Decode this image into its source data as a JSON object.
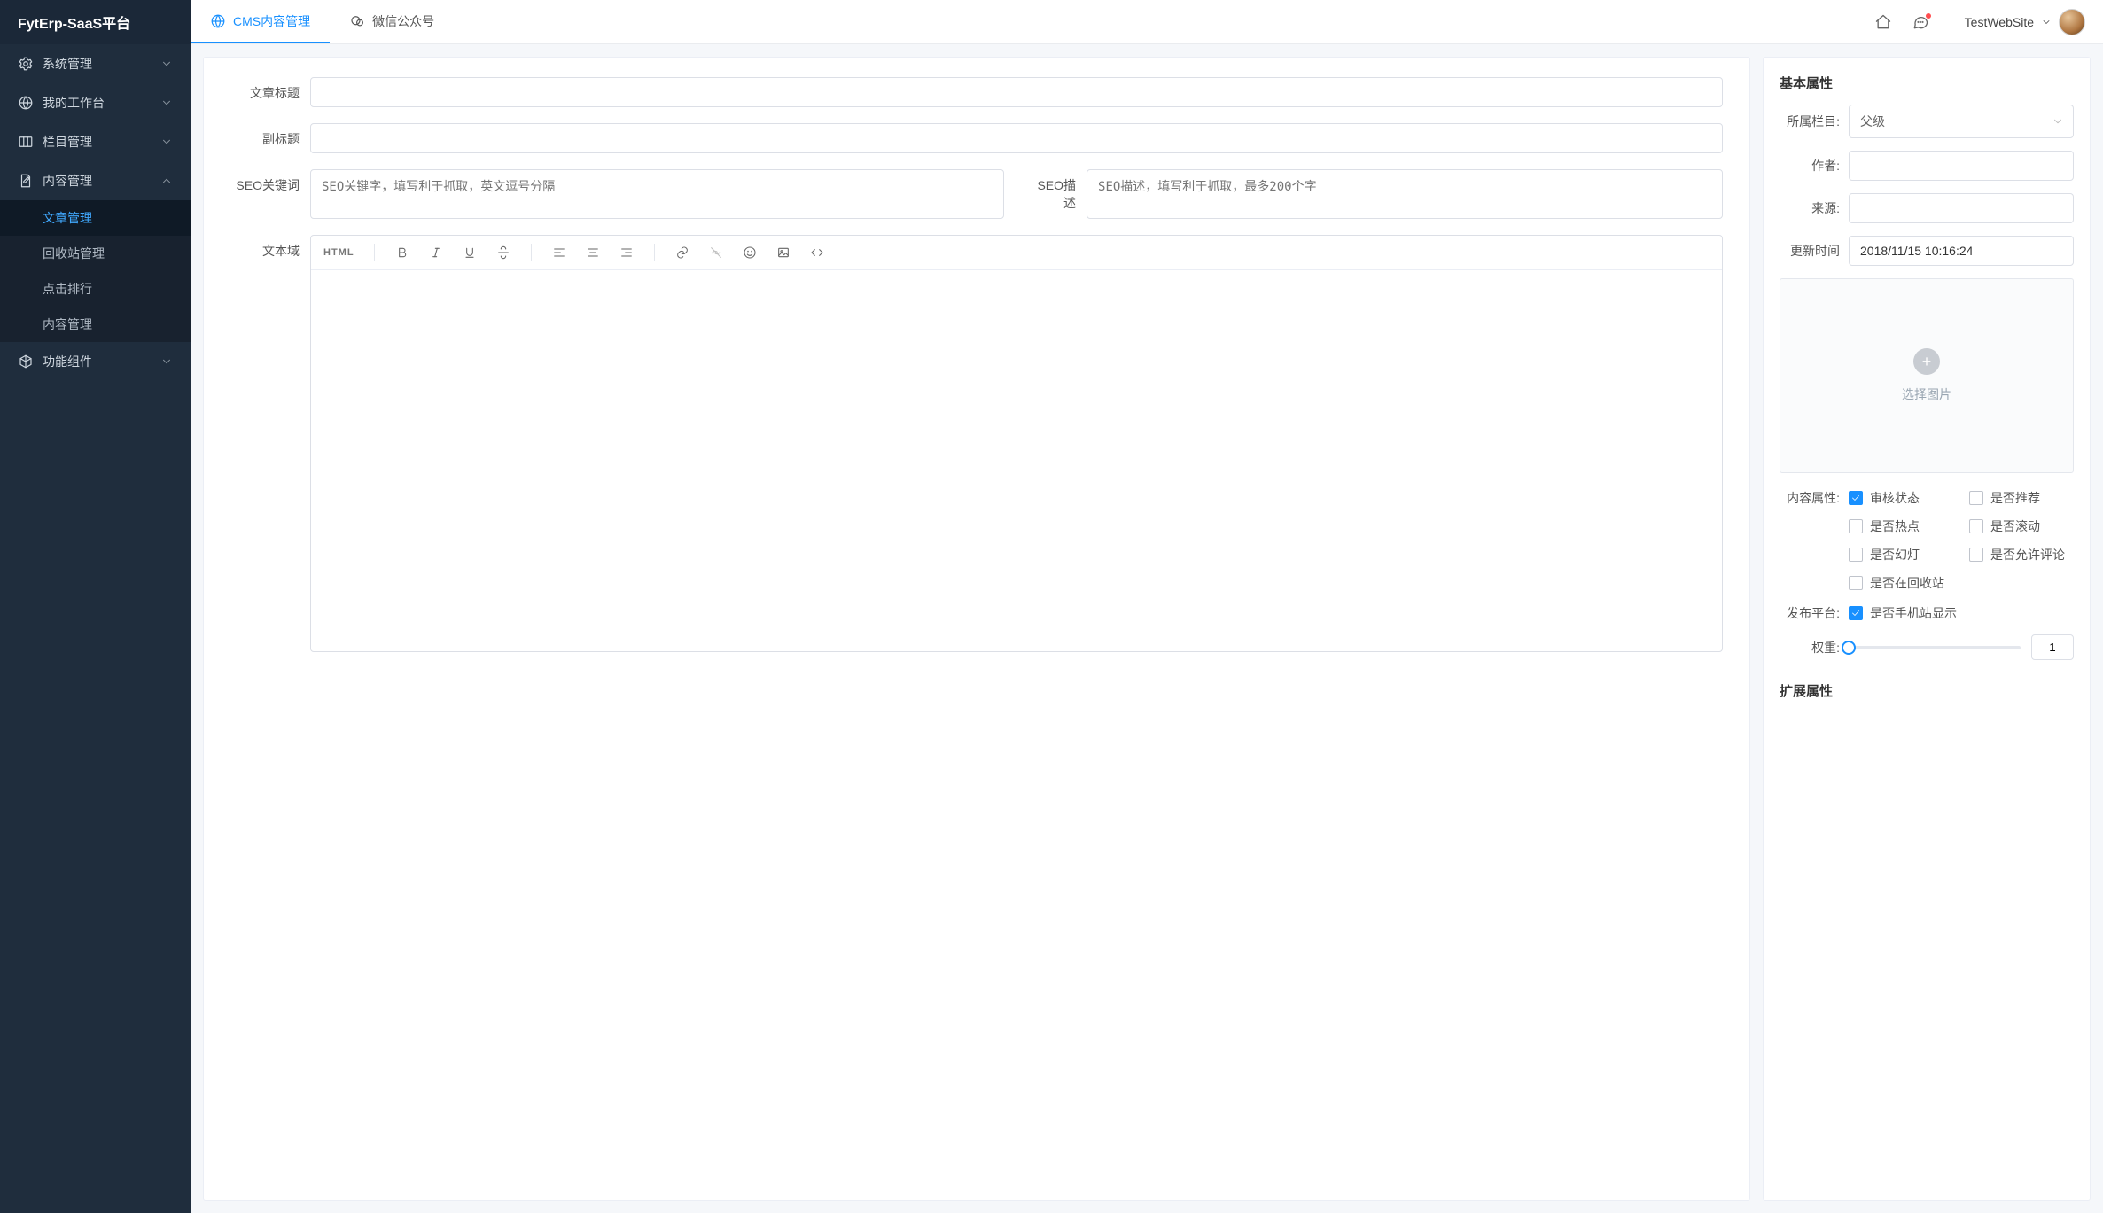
{
  "brand": "FytErp-SaaS平台",
  "header": {
    "tabs": [
      {
        "label": "CMS内容管理",
        "active": true
      },
      {
        "label": "微信公众号",
        "active": false
      }
    ],
    "userName": "TestWebSite"
  },
  "sidebar": {
    "groups": [
      {
        "label": "系统管理",
        "icon": "gear-icon",
        "expanded": false
      },
      {
        "label": "我的工作台",
        "icon": "globe-icon",
        "expanded": false
      },
      {
        "label": "栏目管理",
        "icon": "columns-icon",
        "expanded": false
      },
      {
        "label": "内容管理",
        "icon": "edit-doc-icon",
        "expanded": true,
        "items": [
          {
            "label": "文章管理",
            "active": true
          },
          {
            "label": "回收站管理",
            "active": false
          },
          {
            "label": "点击排行",
            "active": false
          },
          {
            "label": "内容管理",
            "active": false
          }
        ]
      },
      {
        "label": "功能组件",
        "icon": "cube-icon",
        "expanded": false
      }
    ]
  },
  "form": {
    "titleLabel": "文章标题",
    "titleValue": "",
    "subtitleLabel": "副标题",
    "subtitleValue": "",
    "seoKwLabel": "SEO关键词",
    "seoKwPlaceholder": "SEO关键字，填写利于抓取，英文逗号分隔",
    "seoDescLabel": "SEO描述",
    "seoDescPlaceholder": "SEO描述，填写利于抓取，最多200个字",
    "bodyLabel": "文本域",
    "toolbar": {
      "html": "HTML"
    }
  },
  "props": {
    "basicTitle": "基本属性",
    "columnLabel": "所属栏目:",
    "columnValue": "父级",
    "authorLabel": "作者:",
    "authorValue": "",
    "sourceLabel": "来源:",
    "sourceValue": "",
    "updateLabel": "更新时间",
    "updateValue": "2018/11/15 10:16:24",
    "imageUploadLabel": "选择图片",
    "contentAttrLabel": "内容属性:",
    "checks": [
      {
        "label": "审核状态",
        "checked": true
      },
      {
        "label": "是否推荐",
        "checked": false
      },
      {
        "label": "是否热点",
        "checked": false
      },
      {
        "label": "是否滚动",
        "checked": false
      },
      {
        "label": "是否幻灯",
        "checked": false
      },
      {
        "label": "是否允许评论",
        "checked": false
      },
      {
        "label": "是否在回收站",
        "checked": false
      }
    ],
    "platformLabel": "发布平台:",
    "platformCheck": {
      "label": "是否手机站显示",
      "checked": true
    },
    "weightLabel": "权重:",
    "weightValue": "1",
    "extTitle": "扩展属性"
  }
}
